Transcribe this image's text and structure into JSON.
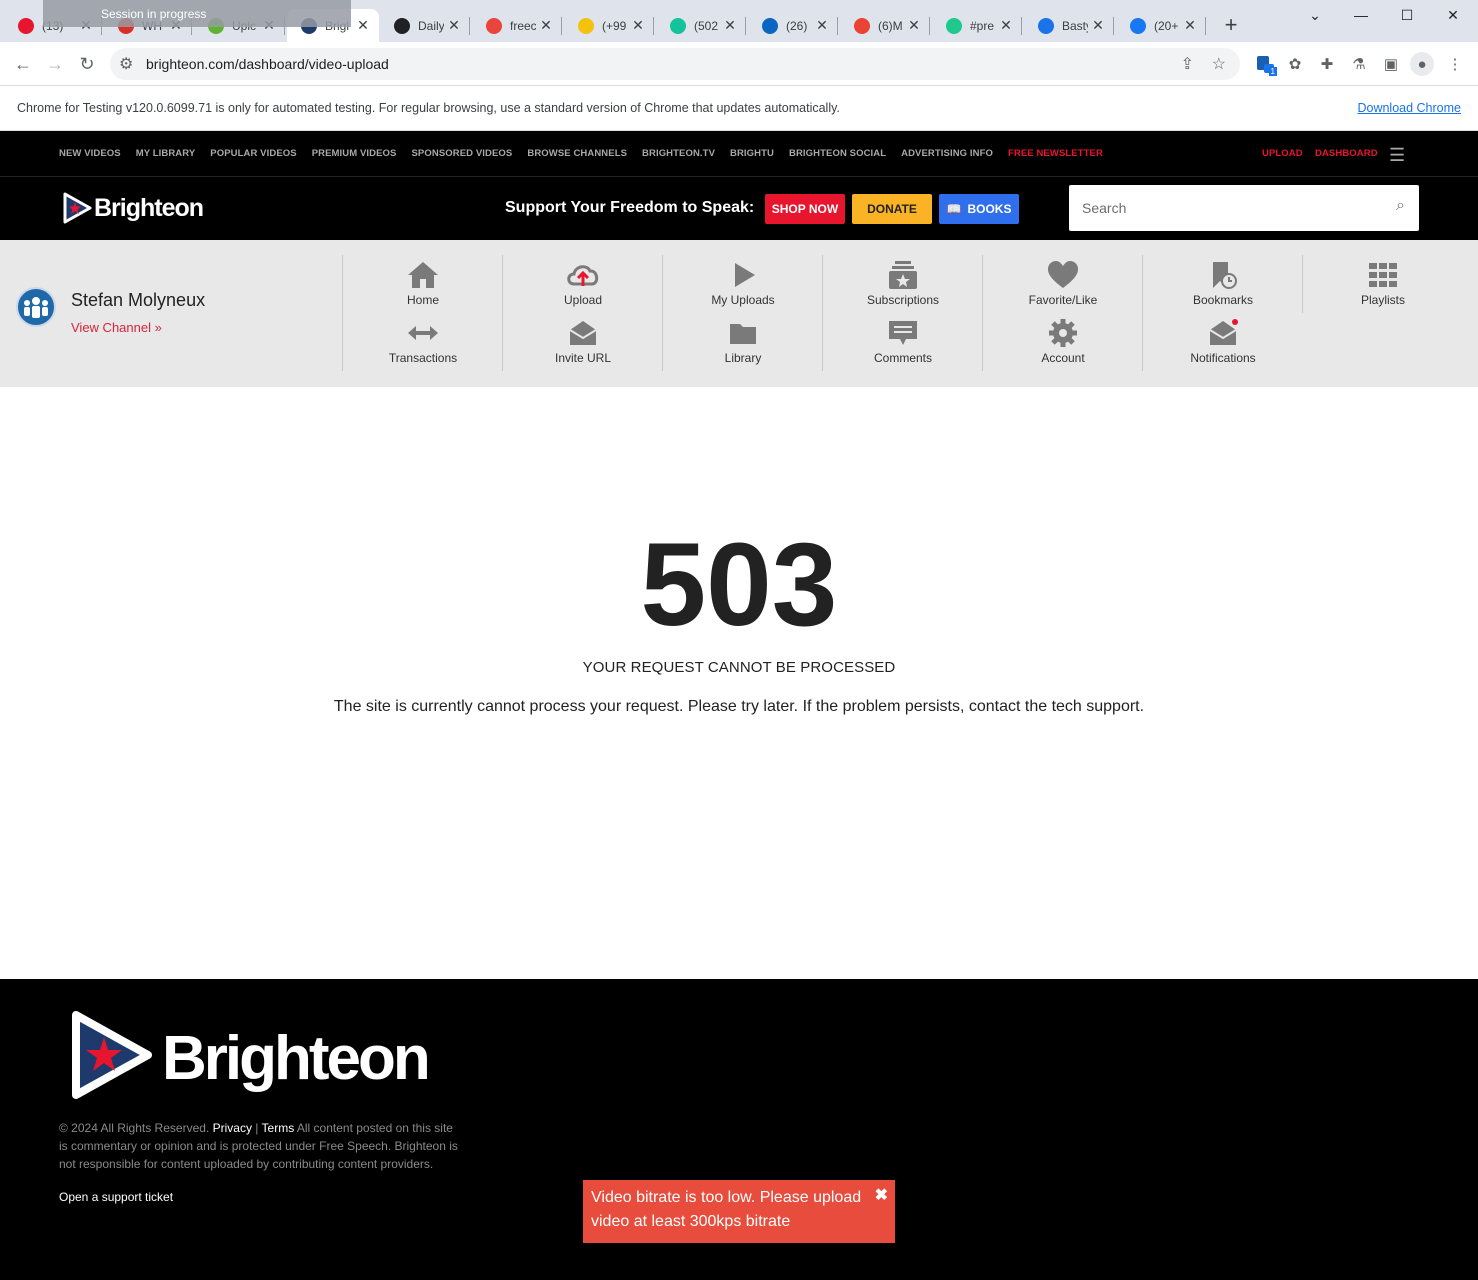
{
  "browser": {
    "session_label": "Session in progress",
    "tabs": [
      {
        "title": "(13)",
        "color": "#e8152f"
      },
      {
        "title": "WH",
        "color": "#d93025"
      },
      {
        "title": "Uplc",
        "color": "#5fb130"
      },
      {
        "title": "Brigl",
        "color": "#1e3a6d"
      },
      {
        "title": "Daily",
        "color": "#202124"
      },
      {
        "title": "freec",
        "color": "#e8453c"
      },
      {
        "title": "(+99",
        "color": "#f4c20d"
      },
      {
        "title": "(502",
        "color": "#15c39a"
      },
      {
        "title": "(26)",
        "color": "#0a66c2"
      },
      {
        "title": "(6)M",
        "color": "#ea4335"
      },
      {
        "title": "#pre",
        "color": "#1fc98c"
      },
      {
        "title": "Basty",
        "color": "#1a73e8"
      },
      {
        "title": "(20+",
        "color": "#1877f2"
      }
    ],
    "url": "brighteon.com/dashboard/video-upload",
    "infobar_text": "Chrome for Testing v120.0.6099.71 is only for automated testing. For regular browsing, use a standard version of Chrome that updates automatically.",
    "infobar_link": "Download Chrome",
    "extension_badge": "1"
  },
  "topnav": {
    "links": [
      "NEW VIDEOS",
      "MY LIBRARY",
      "POPULAR VIDEOS",
      "PREMIUM VIDEOS",
      "SPONSORED VIDEOS",
      "BROWSE CHANNELS",
      "BRIGHTEON.TV",
      "BRIGHTU",
      "BRIGHTEON SOCIAL",
      "ADVERTISING INFO"
    ],
    "newsletter": "FREE NEWSLETTER",
    "upload": "UPLOAD",
    "dashboard": "DASHBOARD"
  },
  "header": {
    "logo": "Brighteon",
    "tagline": "Support Your Freedom to Speak:",
    "shop": "SHOP NOW",
    "donate": "DONATE",
    "books": "BOOKS",
    "search_placeholder": "Search"
  },
  "dashboard": {
    "user_name": "Stefan Molyneux",
    "view_channel": "View Channel »",
    "items": {
      "home": "Home",
      "transactions": "Transactions",
      "upload": "Upload",
      "invite_url": "Invite URL",
      "my_uploads": "My Uploads",
      "library": "Library",
      "subscriptions": "Subscriptions",
      "comments": "Comments",
      "favorite": "Favorite/Like",
      "account": "Account",
      "bookmarks": "Bookmarks",
      "notifications": "Notifications",
      "playlists": "Playlists"
    }
  },
  "error": {
    "code": "503",
    "title": "YOUR REQUEST CANNOT BE PROCESSED",
    "message": "The site is currently cannot process your request. Please try later. If the problem persists, contact the tech support."
  },
  "footer": {
    "logo": "Brighteon",
    "copyright": "© 2024 All Rights Reserved.",
    "privacy": "Privacy",
    "terms": "Terms",
    "disclaimer": "All content posted on this site is commentary or opinion and is protected under Free Speech. Brighteon is not responsible for content uploaded by contributing content providers.",
    "support": "Open a support ticket"
  },
  "toast": {
    "message": "Video bitrate is too low. Please upload video at least 300kps bitrate",
    "close": "✖"
  }
}
